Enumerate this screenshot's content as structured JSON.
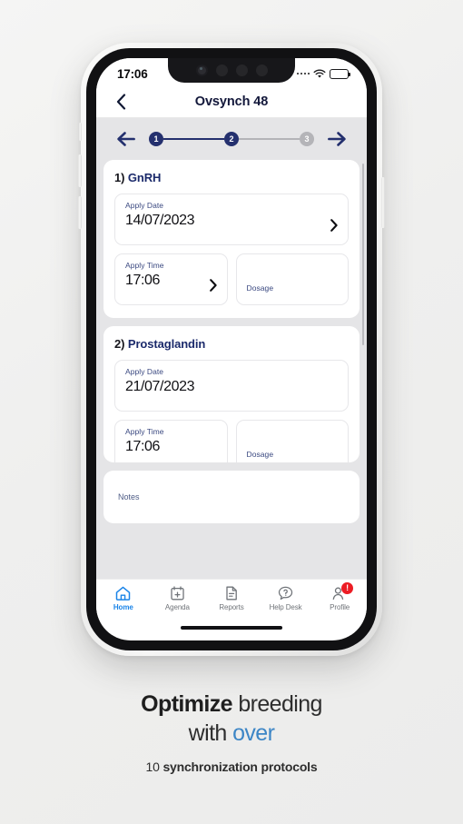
{
  "status_bar": {
    "time": "17:06",
    "signal_icon": "signal-dots-icon",
    "wifi_icon": "wifi-icon",
    "battery_icon": "battery-icon"
  },
  "header": {
    "back_icon": "chevron-left-icon",
    "title": "Ovsynch 48"
  },
  "stepper": {
    "prev_icon": "arrow-left-icon",
    "next_icon": "arrow-right-icon",
    "steps": [
      {
        "label": "1",
        "state": "active"
      },
      {
        "label": "2",
        "state": "active"
      },
      {
        "label": "3",
        "state": "inactive"
      }
    ]
  },
  "protocols": [
    {
      "number": "1)",
      "name": "GnRH",
      "apply_date": {
        "label": "Apply Date",
        "value": "14/07/2023",
        "chevron": "chevron-right-icon"
      },
      "apply_time": {
        "label": "Apply Time",
        "value": "17:06",
        "chevron": "chevron-right-icon"
      },
      "dosage": {
        "label": "Dosage",
        "value": ""
      }
    },
    {
      "number": "2)",
      "name": "Prostaglandin",
      "apply_date": {
        "label": "Apply Date",
        "value": "21/07/2023",
        "chevron": ""
      },
      "apply_time": {
        "label": "Apply Time",
        "value": "17:06",
        "chevron": ""
      },
      "dosage": {
        "label": "Dosage",
        "value": ""
      }
    }
  ],
  "notes": {
    "label": "Notes",
    "value": ""
  },
  "bottom_nav": [
    {
      "label": "Home",
      "icon": "home-icon",
      "active": true
    },
    {
      "label": "Agenda",
      "icon": "calendar-plus-icon",
      "active": false
    },
    {
      "label": "Reports",
      "icon": "document-icon",
      "active": false
    },
    {
      "label": "Help Desk",
      "icon": "question-bubble-icon",
      "active": false
    },
    {
      "label": "Profile",
      "icon": "person-icon",
      "active": false,
      "badge": "!"
    }
  ],
  "caption": {
    "line1_bold": "Optimize",
    "line1_rest": "breeding",
    "line2_rest": "with",
    "line2_blue": "over",
    "line3_num": "10",
    "line3_bold": "synchronization protocols"
  },
  "colors": {
    "navy": "#24306e",
    "accent_blue": "#1a84e8",
    "caption_blue": "#3d86c6",
    "badge_red": "#ec1c24",
    "app_bg": "#e5e5e7"
  }
}
